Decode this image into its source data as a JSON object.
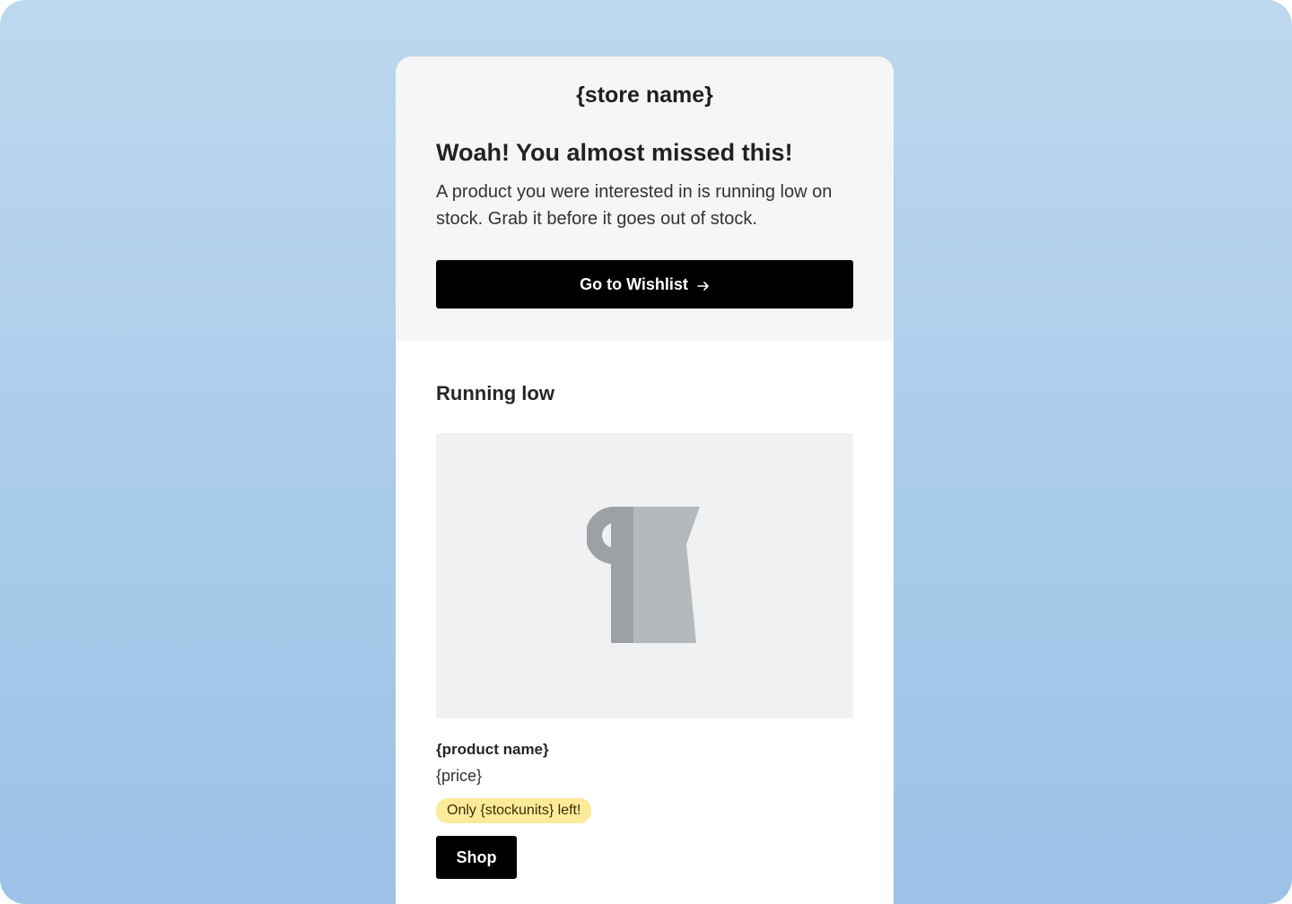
{
  "header": {
    "store_name": "{store name}",
    "headline": "Woah! You almost missed this!",
    "intro": "A product you were interested in is running low on stock. Grab it before it goes out of stock.",
    "cta_label": "Go to Wishlist",
    "cta_icon": "arrow-right-icon"
  },
  "section": {
    "title": "Running low"
  },
  "product": {
    "image_icon": "pitcher-icon",
    "name": "{product name}",
    "price": "{price}",
    "stock_badge": "Only {stockunits} left!",
    "shop_label": "Shop"
  },
  "colors": {
    "background_top": "#bdd8ef",
    "background_bottom": "#9dc2e7",
    "header_bg": "#f6f6f6",
    "button_bg": "#000000",
    "badge_bg": "#fdea9a",
    "image_bg": "#eff1f2"
  }
}
